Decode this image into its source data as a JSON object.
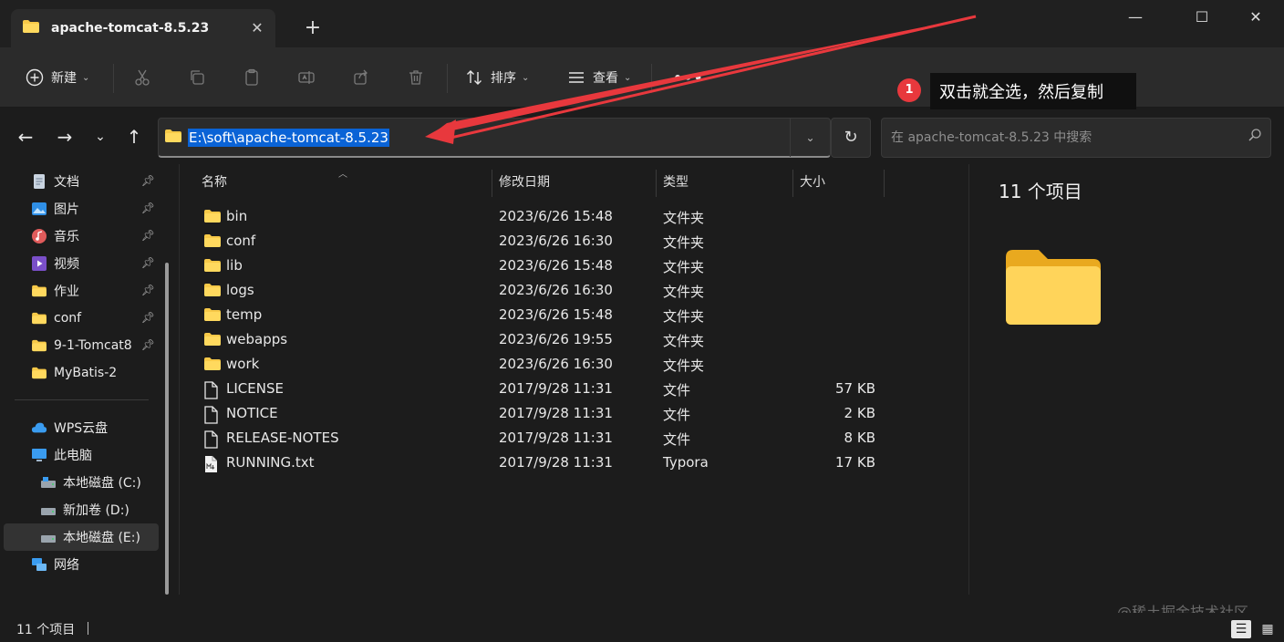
{
  "window": {
    "tab_title": "apache-tomcat-8.5.23",
    "tab_close": "✕",
    "new_tab": "+",
    "minimize": "—",
    "maximize": "☐",
    "close": "✕"
  },
  "toolbar": {
    "new_label": "新建",
    "sort_label": "排序",
    "view_label": "查看",
    "more": "•••"
  },
  "address": {
    "path": "E:\\soft\\apache-tomcat-8.5.23"
  },
  "search": {
    "placeholder": "在 apache-tomcat-8.5.23 中搜索"
  },
  "sidebar": {
    "items": [
      {
        "label": "文档",
        "icon": "document-icon"
      },
      {
        "label": "图片",
        "icon": "pictures-icon"
      },
      {
        "label": "音乐",
        "icon": "music-icon"
      },
      {
        "label": "视频",
        "icon": "video-icon"
      },
      {
        "label": "作业",
        "icon": "folder-icon"
      },
      {
        "label": "conf",
        "icon": "folder-icon"
      },
      {
        "label": "9-1-Tomcat8",
        "icon": "folder-icon"
      },
      {
        "label": "MyBatis-2",
        "icon": "folder-icon"
      },
      {
        "label": "WPS云盘",
        "icon": "cloud-icon"
      },
      {
        "label": "此电脑",
        "icon": "computer-icon"
      },
      {
        "label": "本地磁盘 (C:)",
        "icon": "drive-icon"
      },
      {
        "label": "新加卷 (D:)",
        "icon": "drive-icon"
      },
      {
        "label": "本地磁盘 (E:)",
        "icon": "drive-icon"
      },
      {
        "label": "网络",
        "icon": "network-icon"
      }
    ]
  },
  "columns": {
    "name": "名称",
    "date": "修改日期",
    "type": "类型",
    "size": "大小"
  },
  "files": [
    {
      "name": "bin",
      "date": "2023/6/26 15:48",
      "type": "文件夹",
      "size": ""
    },
    {
      "name": "conf",
      "date": "2023/6/26 16:30",
      "type": "文件夹",
      "size": ""
    },
    {
      "name": "lib",
      "date": "2023/6/26 15:48",
      "type": "文件夹",
      "size": ""
    },
    {
      "name": "logs",
      "date": "2023/6/26 16:30",
      "type": "文件夹",
      "size": ""
    },
    {
      "name": "temp",
      "date": "2023/6/26 15:48",
      "type": "文件夹",
      "size": ""
    },
    {
      "name": "webapps",
      "date": "2023/6/26 19:55",
      "type": "文件夹",
      "size": ""
    },
    {
      "name": "work",
      "date": "2023/6/26 16:30",
      "type": "文件夹",
      "size": ""
    },
    {
      "name": "LICENSE",
      "date": "2017/9/28 11:31",
      "type": "文件",
      "size": "57 KB"
    },
    {
      "name": "NOTICE",
      "date": "2017/9/28 11:31",
      "type": "文件",
      "size": "2 KB"
    },
    {
      "name": "RELEASE-NOTES",
      "date": "2017/9/28 11:31",
      "type": "文件",
      "size": "8 KB"
    },
    {
      "name": "RUNNING.txt",
      "date": "2017/9/28 11:31",
      "type": "Typora",
      "size": "17 KB"
    }
  ],
  "preview": {
    "title": "11 个项目"
  },
  "status": {
    "count": "11 个项目"
  },
  "annotation": {
    "badge": "1",
    "text": "双击就全选，然后复制",
    "arrow_color": "#e8383d"
  },
  "watermark": "@稀土掘金技术社区",
  "colors": {
    "folder": "#f7c948",
    "selection": "#0a63d6"
  }
}
